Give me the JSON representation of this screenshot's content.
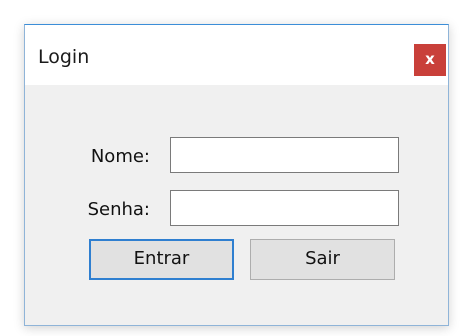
{
  "window": {
    "title": "Login",
    "close_label": "x"
  },
  "form": {
    "nome_label": "Nome:",
    "nome_value": "",
    "senha_label": "Senha:",
    "senha_value": ""
  },
  "buttons": {
    "entrar_label": "Entrar",
    "sair_label": "Sair"
  },
  "colors": {
    "close_bg": "#c9403a",
    "focus_border": "#2f7fd0",
    "dialog_bg": "#f0f0f0"
  }
}
